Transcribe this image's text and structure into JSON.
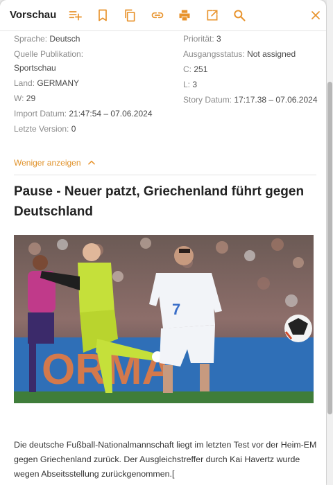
{
  "toolbar": {
    "title": "Vorschau",
    "icons": [
      "playlist-add-icon",
      "bookmark-icon",
      "copy-icon",
      "link-icon",
      "print-icon",
      "open-external-icon",
      "search-icon",
      "close-icon"
    ],
    "accent_color": "#e8932c"
  },
  "meta": {
    "left": [
      {
        "label": "Sprache:",
        "value": "Deutsch"
      },
      {
        "label": "Quelle Publikation:",
        "value": "Sportschau"
      },
      {
        "label": "Land:",
        "value": "GERMANY"
      },
      {
        "label": "W:",
        "value": "29"
      },
      {
        "label": "Import Datum:",
        "value": "21:47:54 – 07.06.2024"
      },
      {
        "label": "Letzte Version:",
        "value": "0"
      }
    ],
    "right": [
      {
        "label": "Priorität:",
        "value": "3"
      },
      {
        "label": "Ausgangsstatus:",
        "value": "Not assigned"
      },
      {
        "label": "C:",
        "value": "251"
      },
      {
        "label": "L:",
        "value": "3"
      },
      {
        "label": "Story Datum:",
        "value": "17:17.38 – 07.06.2024"
      }
    ]
  },
  "toggle": {
    "label": "Weniger anzeigen"
  },
  "article": {
    "headline": "Pause - Neuer patzt, Griechenland führt gegen Deutschland",
    "body": "Die deutsche Fußball-Nationalmannschaft liegt im letzten Test vor der Heim-EM gegen Griechenland zurück. Der Ausgleichstreffer durch Kai Havertz wurde wegen Abseitsstellung zurückgenommen.[",
    "image_board_text": "ORMA"
  }
}
